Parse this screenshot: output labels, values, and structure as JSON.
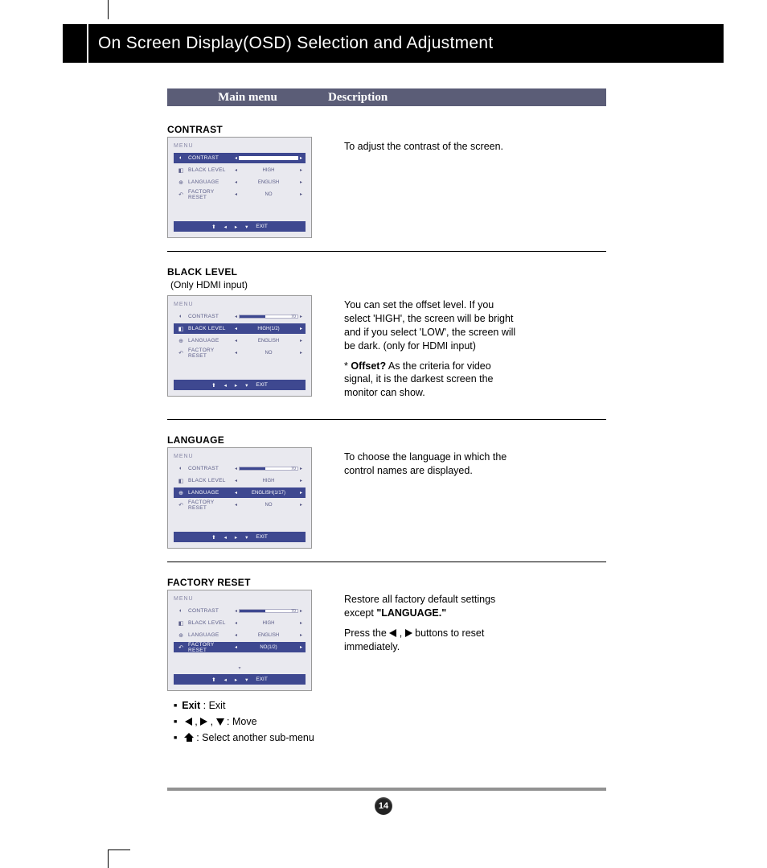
{
  "header": {
    "title": "On Screen Display(OSD) Selection and Adjustment"
  },
  "columns": {
    "main_menu": "Main menu",
    "description": "Description"
  },
  "osd_common": {
    "menu_label": "MENU",
    "exit": "EXIT",
    "items": {
      "contrast": "CONTRAST",
      "black_level": "BLACK LEVEL",
      "language": "LANGUAGE",
      "factory_reset": "FACTORY RESET"
    },
    "values": {
      "high": "HIGH",
      "high_sel": "HIGH(1/2)",
      "english": "ENGLISH",
      "english_sel": "ENGLISH(1/17)",
      "no": "NO",
      "no_sel": "NO(1/2)",
      "slider_num": "70"
    }
  },
  "sections": {
    "contrast": {
      "title": "CONTRAST",
      "desc": "To adjust the contrast of the screen."
    },
    "black_level": {
      "title": "BLACK LEVEL",
      "sub": "(Only HDMI input)",
      "desc1": "You can set the offset level. If you select 'HIGH', the screen will be bright and if you select 'LOW', the screen will be dark. (only for HDMI input)",
      "desc2a": "* ",
      "desc2b": "Offset?",
      "desc2c": " As the criteria for video signal, it is the darkest screen the monitor can show."
    },
    "language": {
      "title": "LANGUAGE",
      "desc": "To choose the language in which the control names are displayed."
    },
    "factory_reset": {
      "title": "FACTORY RESET",
      "desc1": "Restore all factory default settings except ",
      "desc1b": "\"LANGUAGE.\"",
      "desc2a": "Press the ",
      "desc2b": " , ",
      "desc2c": " buttons to reset immediately."
    }
  },
  "legend": {
    "exit_bold": "Exit",
    "exit_rest": " : Exit",
    "move": " : Move",
    "select": " : Select another sub-menu"
  },
  "page_number": "14"
}
